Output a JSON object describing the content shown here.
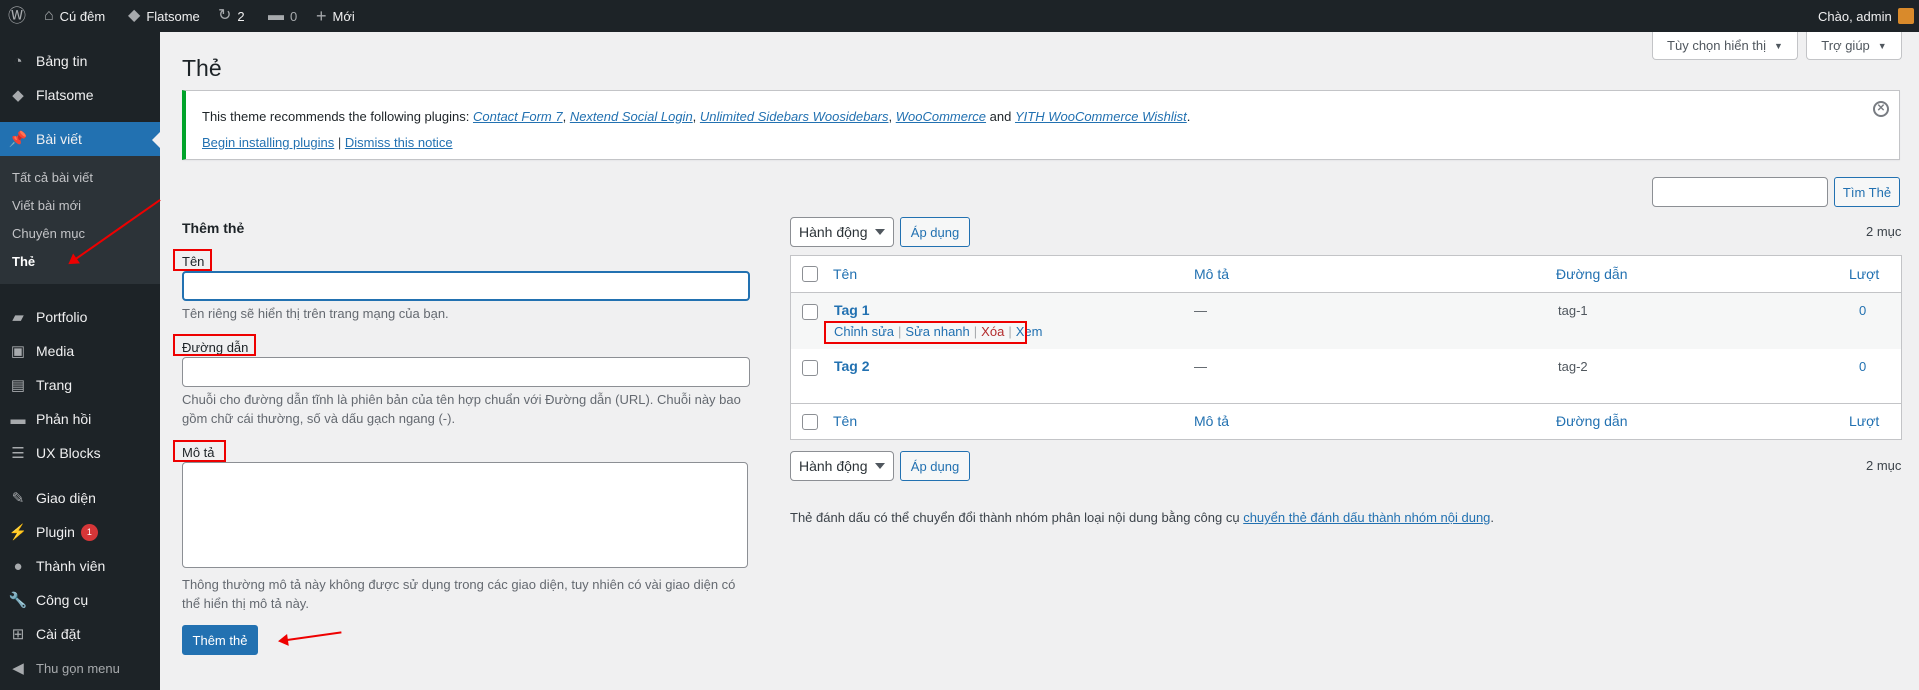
{
  "admin_bar": {
    "site_name": "Cú đêm",
    "theme": "Flatsome",
    "updates": "2",
    "comments": "0",
    "new": "Mới",
    "greeting": "Chào, admin"
  },
  "sidebar": {
    "items": [
      {
        "label": "Bảng tin",
        "icon": "dashboard-icon"
      },
      {
        "label": "Flatsome",
        "icon": "flatsome-icon"
      },
      {
        "label": "Bài viết",
        "icon": "pin-icon"
      },
      {
        "label": "Portfolio",
        "icon": "folder-icon"
      },
      {
        "label": "Media",
        "icon": "media-icon"
      },
      {
        "label": "Trang",
        "icon": "page-icon"
      },
      {
        "label": "Phản hồi",
        "icon": "comment-icon"
      },
      {
        "label": "UX Blocks",
        "icon": "blocks-icon"
      },
      {
        "label": "Giao diện",
        "icon": "brush-icon"
      },
      {
        "label": "Plugin",
        "icon": "plugin-icon",
        "badge": "1"
      },
      {
        "label": "Thành viên",
        "icon": "user-icon"
      },
      {
        "label": "Công cụ",
        "icon": "wrench-icon"
      },
      {
        "label": "Cài đặt",
        "icon": "settings-icon"
      },
      {
        "label": "Thu gọn menu",
        "icon": "collapse-icon"
      }
    ],
    "submenu": [
      "Tất cả bài viết",
      "Viết bài mới",
      "Chuyên mục",
      "Thẻ"
    ]
  },
  "screen_options": "Tùy chọn hiển thị",
  "help": "Trợ giúp",
  "page_title": "Thẻ",
  "notice": {
    "prefix": "This theme recommends the following plugins:",
    "plugins": [
      "Contact Form 7",
      "Nextend Social Login",
      "Unlimited Sidebars Woosidebars",
      "WooCommerce",
      "YITH WooCommerce Wishlist"
    ],
    "and": "and",
    "begin": "Begin installing plugins",
    "sep": "|",
    "dismiss": "Dismiss this notice"
  },
  "search_button": "Tìm Thẻ",
  "add_form": {
    "heading": "Thêm thẻ",
    "name_label": "Tên",
    "name_hint": "Tên riêng sẽ hiển thị trên trang mạng của bạn.",
    "slug_label": "Đường dẫn",
    "slug_hint_1": "Chuỗi cho đường dẫn tĩnh là phiên bản của tên hợp chuẩn với Đường dẫn (URL). Chuỗi này bao",
    "slug_hint_2": "gồm chữ cái thường, số và dấu gạch ngang (-).",
    "desc_label": "Mô tả",
    "desc_hint_1": "Thông thường mô tả này không được sử dụng trong các giao diện, tuy nhiên có vài giao diện có",
    "desc_hint_2": "thể hiển thị mô tả này.",
    "submit": "Thêm thẻ"
  },
  "bulk": {
    "action": "Hành động",
    "apply": "Áp dụng",
    "count": "2 mục"
  },
  "table": {
    "headers": [
      "Tên",
      "Mô tả",
      "Đường dẫn",
      "Lượt"
    ],
    "rows": [
      {
        "name": "Tag 1",
        "desc": "—",
        "slug": "tag-1",
        "count": "0"
      },
      {
        "name": "Tag 2",
        "desc": "—",
        "slug": "tag-2",
        "count": "0"
      }
    ],
    "row_actions": [
      "Chỉnh sửa",
      "Sửa nhanh",
      "Xóa",
      "Xem"
    ]
  },
  "footer_note": {
    "text": "Thẻ đánh dấu có thể chuyển đổi thành nhóm phân loại nội dung bằng công cụ",
    "link": "chuyển thẻ đánh dấu thành nhóm nội dung",
    "end": "."
  }
}
